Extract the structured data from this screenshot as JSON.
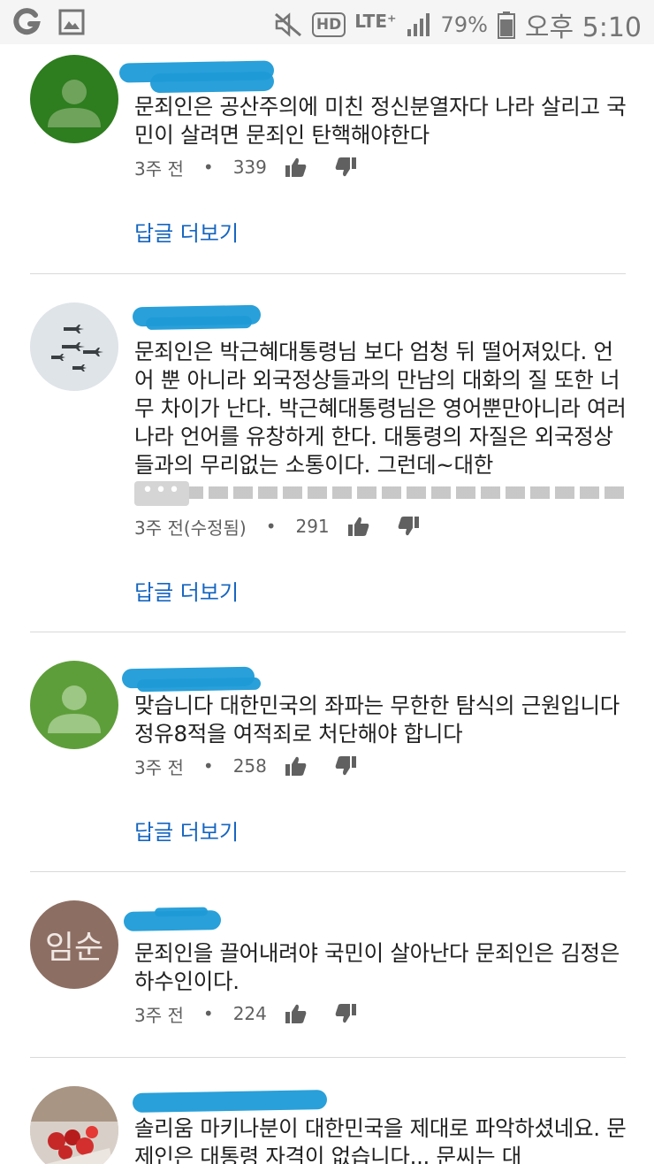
{
  "status_bar": {
    "battery_percent": "79%",
    "time": "오후 5:10",
    "network": "LTE⁺",
    "hd_label": "HD"
  },
  "comments": [
    {
      "avatar": "default-person-dark-green",
      "text": "문죄인은 공산주의에 미친 정신분열자다 나라 살리고 국민이 살려면 문죄인 탄핵해야한다",
      "time": "3주 전",
      "likes": "339",
      "more_replies": "답글 더보기"
    },
    {
      "avatar": "airplanes-photo",
      "text": "문죄인은 박근혜대통령님 보다 엄청 뒤 떨어져있다. 언어 뿐 아니라 외국정상들과의 만남의 대화의 질 또한 너무 차이가 난다. 박근혜대통령님은 영어뿐만아니라 여러나라 언어를 유창하게 한다. 대통령의 자질은 외국정상들과의 무리없는 소통이다. 그런데~대한",
      "time": "3주 전(수정됨)",
      "likes": "291",
      "ellipsis": "•••",
      "more_replies": "답글 더보기"
    },
    {
      "avatar": "default-person-light-green",
      "text": "맞습니다 대한민국의 좌파는 무한한 탐식의 근원입니다 정유8적을 여적죄로 처단해야 합니다",
      "time": "3주 전",
      "likes": "258",
      "more_replies": "답글 더보기"
    },
    {
      "avatar_initials": "임순",
      "text": "문죄인을 끌어내려야 국민이 살아난다 문죄인은 김정은 하수인이다.",
      "time": "3주 전",
      "likes": "224"
    },
    {
      "avatar": "flowers-photo",
      "text": "솔리움 마키나분이 대한민국을 제대로 파악하셨네요. 문제인은 대통령 자격이 없습니다... 문씨는 대"
    }
  ],
  "colors": {
    "link": "#1565c0",
    "username_redaction": "#1e9bd7",
    "meta_text": "#606060"
  }
}
